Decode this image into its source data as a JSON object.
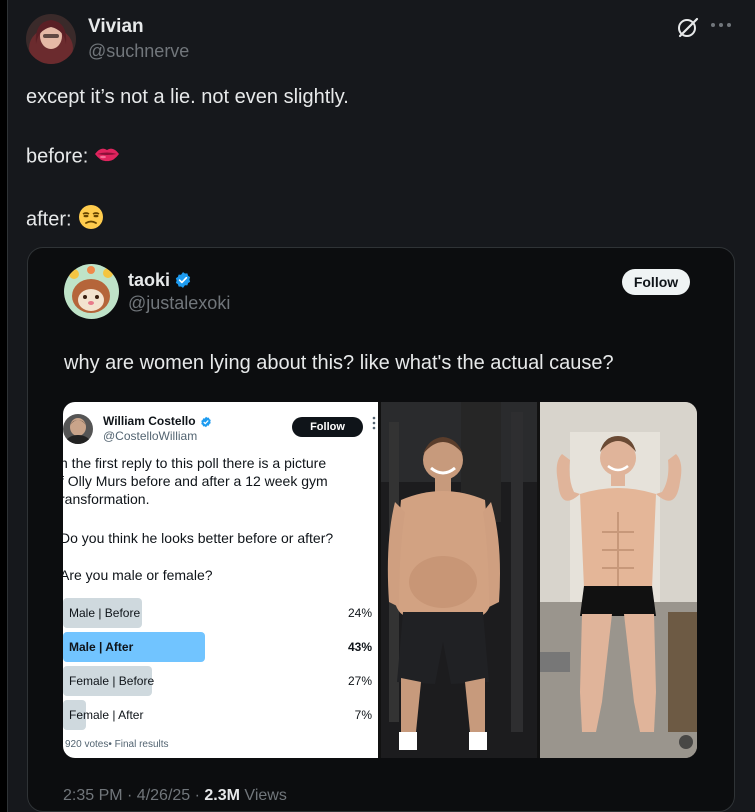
{
  "post": {
    "author_name": "Vivian",
    "author_handle": "@suchnerve",
    "line1": "except it’s not a lie. not even slightly.",
    "line2": "before:",
    "line3": "after:",
    "emoji_before": "lips",
    "emoji_after": "unamused-face"
  },
  "quote": {
    "author_name": "taoki",
    "author_handle": "@justalexoki",
    "follow_label": "Follow",
    "text": "why are women lying about this? like what's the actual cause?",
    "timestamp": "2:35 PM · 4/26/25 · ",
    "views_count": "2.3M",
    "views_label": " Views"
  },
  "poll_card": {
    "author_name": "William Costello",
    "author_handle": "@CostelloWilliam",
    "follow_label": "Follow",
    "lines": [
      "n the first reply to this poll there is a picture",
      "f Olly Murs before and after a 12 week gym",
      "ransformation.",
      "Do you think he looks better before or after?",
      "Are you male or female?"
    ],
    "options": [
      {
        "label": "Male | Before",
        "percent_text": "24%",
        "percent": 24,
        "selected": false
      },
      {
        "label": "Male | After",
        "percent_text": "43%",
        "percent": 43,
        "selected": true
      },
      {
        "label": "Female | Before",
        "percent_text": "27%",
        "percent": 27,
        "selected": false
      },
      {
        "label": "Female | After",
        "percent_text": "7%",
        "percent": 7,
        "selected": false
      }
    ],
    "meta": "920 votes• Final results"
  },
  "colors": {
    "background": "#16181c",
    "quote_bg": "#0c0d0f",
    "text": "#e7e9ea",
    "secondary_text": "#71767b",
    "verified": "#1d9bf0",
    "poll_bar_selected": "#71c4ff",
    "poll_bar": "#cfd9de"
  }
}
